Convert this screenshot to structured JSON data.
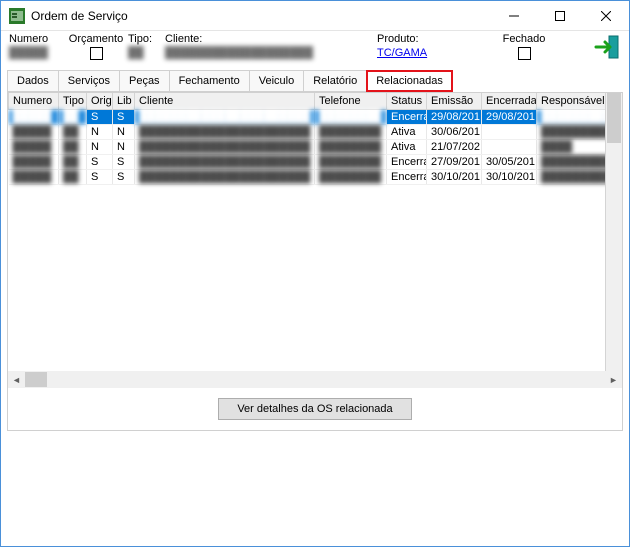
{
  "titlebar": {
    "title": "Ordem de Serviço"
  },
  "header": {
    "numero_label": "Numero",
    "numero_value": "█████",
    "orcamento_label": "Orçamento",
    "tipo_label": "Tipo:",
    "tipo_value": "██",
    "cliente_label": "Cliente:",
    "cliente_value": "███████████████████",
    "produto_label": "Produto:",
    "produto_value": "TC/GAMA",
    "fechado_label": "Fechado"
  },
  "tabs": {
    "t0": "Dados",
    "t1": "Serviços",
    "t2": "Peças",
    "t3": "Fechamento",
    "t4": "Veiculo",
    "t5": "Relatório",
    "t6": "Relacionadas"
  },
  "columns": {
    "numero": "Numero",
    "tipo": "Tipo",
    "orig": "Orig",
    "lib": "Lib",
    "cliente": "Cliente",
    "telefone": "Telefone",
    "status": "Status",
    "emissao": "Emissão",
    "encerrada": "Encerrada",
    "responsavel": "Responsável"
  },
  "rows": [
    {
      "numero": "█████",
      "tipo": "██",
      "orig": "S",
      "lib": "S",
      "cliente": "██████████████████████",
      "telefone": "████████",
      "status": "Encerra",
      "emissao": "29/08/201",
      "encerrada": "29/08/201",
      "responsavel": "██████████",
      "selected": true
    },
    {
      "numero": "█████",
      "tipo": "██",
      "orig": "N",
      "lib": "N",
      "cliente": "██████████████████████",
      "telefone": "████████",
      "status": "Ativa",
      "emissao": "30/06/201",
      "encerrada": "",
      "responsavel": "██████████",
      "selected": false
    },
    {
      "numero": "█████",
      "tipo": "██",
      "orig": "N",
      "lib": "N",
      "cliente": "██████████████████████",
      "telefone": "████████",
      "status": "Ativa",
      "emissao": "21/07/202",
      "encerrada": "",
      "responsavel": "████",
      "selected": false
    },
    {
      "numero": "█████",
      "tipo": "██",
      "orig": "S",
      "lib": "S",
      "cliente": "██████████████████████",
      "telefone": "████████",
      "status": "Encerra",
      "emissao": "27/09/201",
      "encerrada": "30/05/201",
      "responsavel": "██████████",
      "selected": false
    },
    {
      "numero": "█████",
      "tipo": "██",
      "orig": "S",
      "lib": "S",
      "cliente": "██████████████████████",
      "telefone": "████████",
      "status": "Encerra",
      "emissao": "30/10/201",
      "encerrada": "30/10/201",
      "responsavel": "██████████",
      "selected": false
    }
  ],
  "footer": {
    "detail_button": "Ver detalhes da OS relacionada"
  }
}
